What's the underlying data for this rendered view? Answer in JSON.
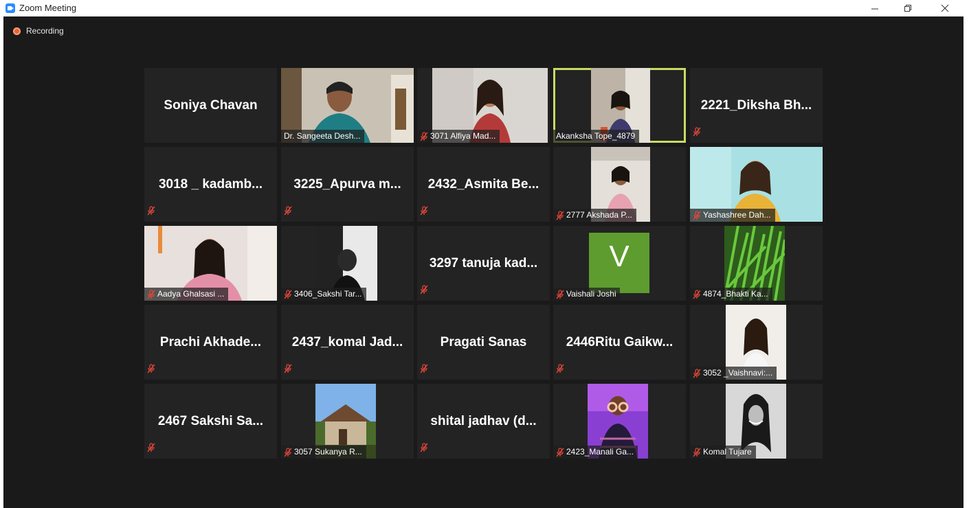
{
  "window": {
    "title": "Zoom Meeting"
  },
  "recording": {
    "label": "Recording"
  },
  "avatar_letter": "V",
  "colors": {
    "active_border": "#c8dc62",
    "mute": "#e0463a",
    "avatar_green": "#5e9c2f",
    "recording": "#e8633a"
  },
  "tiles": [
    {
      "name": "Soniya Chavan",
      "mode": "name"
    },
    {
      "name": "Dr. Sangeeta Desh...",
      "mode": "video",
      "muted": false
    },
    {
      "name": "3071 Alfiya Mad...",
      "mode": "video",
      "muted": true
    },
    {
      "name": "Akanksha Tope_4879",
      "mode": "video",
      "muted": false,
      "active": true
    },
    {
      "name": "2221_Diksha  Bh...",
      "mode": "name",
      "muted": true
    },
    {
      "name": "3018  _  kadamb...",
      "mode": "name",
      "muted": true
    },
    {
      "name": "3225_Apurva  m...",
      "mode": "name",
      "muted": true
    },
    {
      "name": "2432_Asmita  Be...",
      "mode": "name",
      "muted": true
    },
    {
      "name": "2777 Akshada P...",
      "mode": "video",
      "muted": true
    },
    {
      "name": "Yashashree Dah...",
      "mode": "video",
      "muted": true
    },
    {
      "name": "Aadya Ghalsasi ...",
      "mode": "video",
      "muted": true
    },
    {
      "name": "3406_Sakshi Tar...",
      "mode": "video",
      "muted": true
    },
    {
      "name": "3297  tanuja  kad...",
      "mode": "name",
      "muted": true
    },
    {
      "name": "Vaishali Joshi",
      "mode": "avatar",
      "muted": true
    },
    {
      "name": "4874_Bhakti Ka...",
      "mode": "video",
      "muted": true
    },
    {
      "name": "Prachi  Akhade...",
      "mode": "name",
      "muted": true
    },
    {
      "name": "2437_komal  Jad...",
      "mode": "name",
      "muted": true
    },
    {
      "name": "Pragati Sanas",
      "mode": "name",
      "muted": true
    },
    {
      "name": "2446Ritu  Gaikw...",
      "mode": "name",
      "muted": true
    },
    {
      "name": "3052 _Vaishnavi:...",
      "mode": "video",
      "muted": true
    },
    {
      "name": "2467  Sakshi  Sa...",
      "mode": "name",
      "muted": true
    },
    {
      "name": "3057 Sukanya R...",
      "mode": "video",
      "muted": true
    },
    {
      "name": "shital  jadhav  (d...",
      "mode": "name",
      "muted": true
    },
    {
      "name": "2423_Manali Ga...",
      "mode": "video",
      "muted": true
    },
    {
      "name": "Komal Tujare",
      "mode": "video",
      "muted": true
    }
  ]
}
